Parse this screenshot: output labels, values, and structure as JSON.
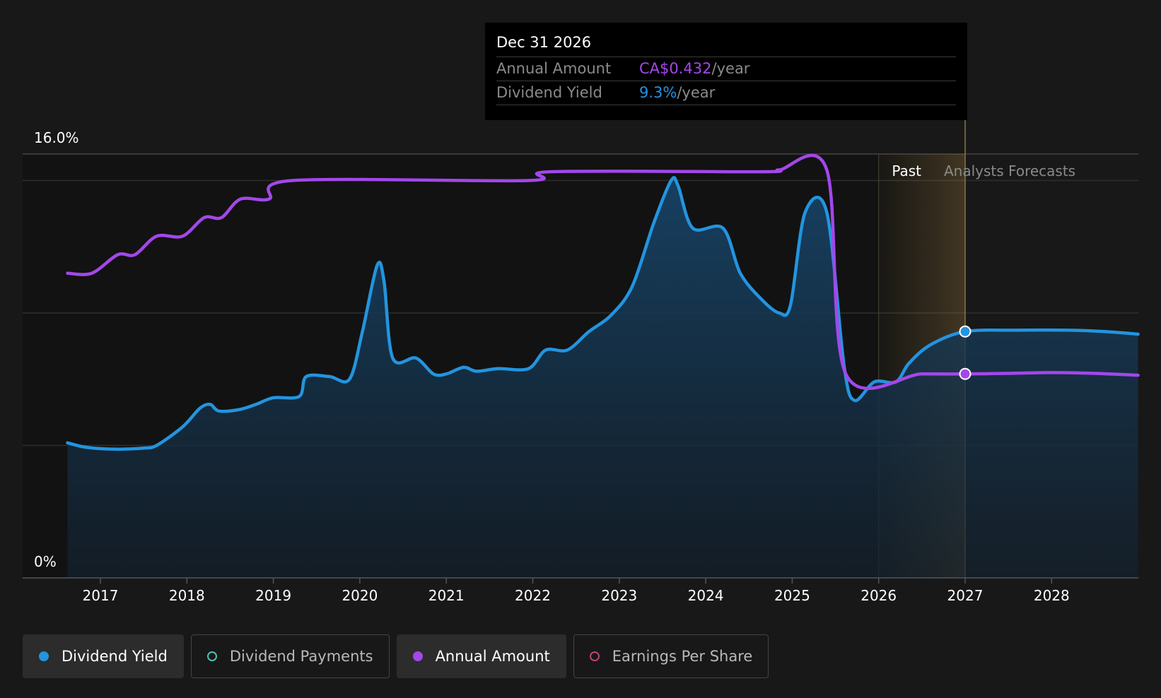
{
  "chart_data": {
    "type": "line",
    "y_tick_labels": [
      "16.0%",
      "0%"
    ],
    "ylim": [
      0,
      16
    ],
    "xlim": [
      2016.5,
      2029.0
    ],
    "x_tick_labels": [
      "2017",
      "2018",
      "2019",
      "2020",
      "2021",
      "2022",
      "2023",
      "2024",
      "2025",
      "2026",
      "2027",
      "2028"
    ],
    "grid": true,
    "region_labels": {
      "past": "Past",
      "forecast": "Analysts Forecasts"
    },
    "series": [
      {
        "name": "Dividend Yield",
        "color": "#2394df",
        "fill": true,
        "points": [
          [
            2016.62,
            5.1
          ],
          [
            2016.8,
            4.95
          ],
          [
            2017.0,
            4.88
          ],
          [
            2017.25,
            4.86
          ],
          [
            2017.5,
            4.9
          ],
          [
            2017.65,
            5.0
          ],
          [
            2017.95,
            5.7
          ],
          [
            2018.15,
            6.4
          ],
          [
            2018.27,
            6.55
          ],
          [
            2018.37,
            6.3
          ],
          [
            2018.6,
            6.35
          ],
          [
            2018.8,
            6.55
          ],
          [
            2019.0,
            6.8
          ],
          [
            2019.3,
            6.85
          ],
          [
            2019.38,
            7.6
          ],
          [
            2019.65,
            7.6
          ],
          [
            2019.88,
            7.5
          ],
          [
            2020.03,
            9.3
          ],
          [
            2020.2,
            11.8
          ],
          [
            2020.28,
            11.2
          ],
          [
            2020.38,
            8.3
          ],
          [
            2020.65,
            8.3
          ],
          [
            2020.85,
            7.7
          ],
          [
            2021.0,
            7.7
          ],
          [
            2021.2,
            7.95
          ],
          [
            2021.35,
            7.8
          ],
          [
            2021.6,
            7.9
          ],
          [
            2021.95,
            7.9
          ],
          [
            2022.15,
            8.6
          ],
          [
            2022.4,
            8.6
          ],
          [
            2022.65,
            9.3
          ],
          [
            2022.9,
            9.9
          ],
          [
            2023.15,
            11.0
          ],
          [
            2023.4,
            13.4
          ],
          [
            2023.6,
            15.0
          ],
          [
            2023.68,
            14.8
          ],
          [
            2023.85,
            13.2
          ],
          [
            2024.2,
            13.2
          ],
          [
            2024.4,
            11.5
          ],
          [
            2024.65,
            10.5
          ],
          [
            2024.85,
            10.0
          ],
          [
            2024.98,
            10.3
          ],
          [
            2025.15,
            13.8
          ],
          [
            2025.4,
            13.8
          ],
          [
            2025.6,
            8.0
          ],
          [
            2025.72,
            6.7
          ],
          [
            2025.95,
            7.4
          ],
          [
            2026.2,
            7.4
          ],
          [
            2026.35,
            8.1
          ],
          [
            2026.6,
            8.8
          ],
          [
            2027.0,
            9.3
          ],
          [
            2027.6,
            9.35
          ],
          [
            2028.2,
            9.35
          ],
          [
            2028.6,
            9.3
          ],
          [
            2029.0,
            9.2
          ]
        ]
      },
      {
        "name": "Annual Amount",
        "color": "#a347ea",
        "fill": false,
        "points": [
          [
            2016.62,
            11.5
          ],
          [
            2016.9,
            11.5
          ],
          [
            2017.2,
            12.2
          ],
          [
            2017.4,
            12.2
          ],
          [
            2017.65,
            12.9
          ],
          [
            2017.95,
            12.9
          ],
          [
            2018.2,
            13.6
          ],
          [
            2018.4,
            13.6
          ],
          [
            2018.62,
            14.3
          ],
          [
            2018.95,
            14.3
          ],
          [
            2019.22,
            15.0
          ],
          [
            2021.95,
            15.0
          ],
          [
            2022.2,
            15.33
          ],
          [
            2024.65,
            15.33
          ],
          [
            2024.85,
            15.4
          ],
          [
            2025.4,
            15.4
          ],
          [
            2025.62,
            7.7
          ],
          [
            2026.5,
            7.7
          ],
          [
            2027.0,
            7.7
          ],
          [
            2027.5,
            7.72
          ],
          [
            2028.0,
            7.75
          ],
          [
            2028.5,
            7.72
          ],
          [
            2029.0,
            7.65
          ]
        ]
      }
    ],
    "tooltip": {
      "date": "Dec 31 2026",
      "rows": [
        {
          "label": "Annual Amount",
          "value": "CA$0.432",
          "unit": "/year",
          "color": "#a347ea"
        },
        {
          "label": "Dividend Yield",
          "value": "9.3%",
          "unit": "/year",
          "color": "#2394df"
        }
      ]
    },
    "legend": [
      {
        "label": "Dividend Yield",
        "color": "#2394df",
        "active": true,
        "marker": "filled"
      },
      {
        "label": "Dividend Payments",
        "color": "#4fc1b1",
        "active": false,
        "marker": "hollow"
      },
      {
        "label": "Annual Amount",
        "color": "#a347ea",
        "active": true,
        "marker": "filled"
      },
      {
        "label": "Earnings Per Share",
        "color": "#c2407b",
        "active": false,
        "marker": "hollow"
      }
    ],
    "past_forecast_divider": 2027.0,
    "forecast_band_start": 2026.0
  }
}
